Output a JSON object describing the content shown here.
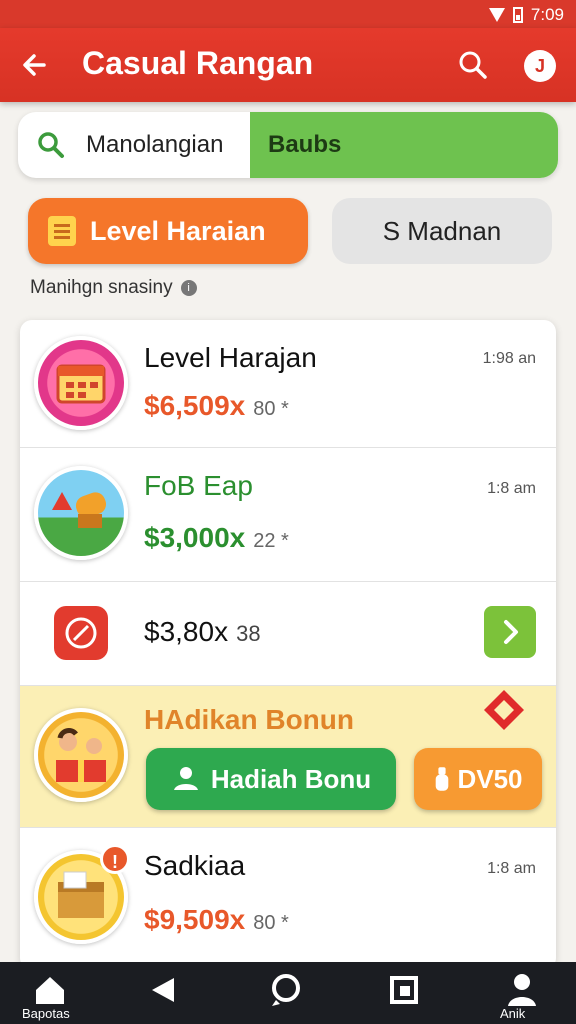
{
  "status_bar": {
    "time": "7:09"
  },
  "app_bar": {
    "title": "Casual Rangan",
    "account_initial": "J"
  },
  "search": {
    "input_value": "Manolangian",
    "tab_label": "Baubs"
  },
  "segments": {
    "left_label": "Level Haraian",
    "right_label": "S Madnan"
  },
  "subheading": "Manihgn snasiny",
  "list": {
    "item1": {
      "name": "Level Harajan",
      "price": "$6,509x",
      "meta": "80 *",
      "time": "1:98 an"
    },
    "item2": {
      "name": "FoB Eap",
      "price": "$3,000x",
      "meta": "22 *",
      "time": "1:8 am"
    },
    "item3": {
      "price": "$3,80x",
      "meta": "38"
    },
    "item4": {
      "title": "HAdikan Bonun",
      "button_label": "Hadiah Bonu",
      "secondary_label": "DV50"
    },
    "item5": {
      "name": "Sadkiaa",
      "price": "$9,509x",
      "meta": "80 *",
      "time": "1:8 am",
      "badge": "!"
    }
  },
  "bottom_nav": {
    "home_label": "Bapotas",
    "profile_label": "Anik"
  },
  "colors": {
    "primary": "#d9392b",
    "accent_green": "#6ec24f",
    "accent_orange": "#f5762a",
    "bonus_bg": "#fbefb5"
  }
}
